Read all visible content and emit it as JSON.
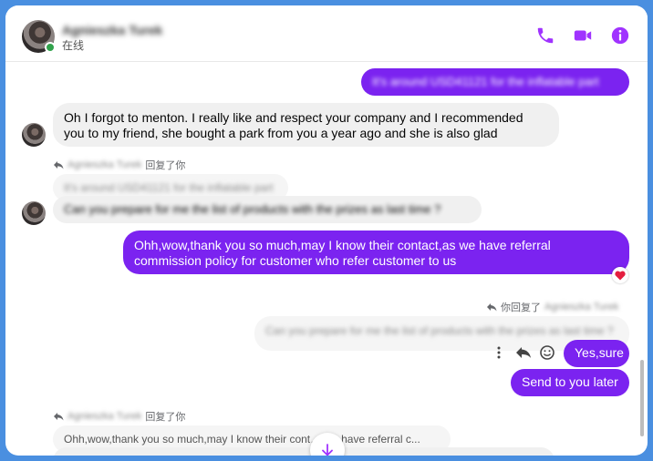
{
  "header": {
    "contact_name": "Agnieszka Turek",
    "status": "在线",
    "accent_color": "#a033ff"
  },
  "messages": [
    {
      "id": "m1",
      "direction": "out",
      "text": "It's around USD41121 for the inflatable part"
    },
    {
      "id": "m2",
      "direction": "in",
      "text_line1": "Oh I forgot to menton. I really like and respect your company and I recommended",
      "text_line2": "you to my friend, she bought a park from you a year ago and she is also glad"
    },
    {
      "id": "m3",
      "direction": "in",
      "reply_header_name": "Agnieszka Turek",
      "reply_header_suffix": "回复了你",
      "quoted_text": "It's around USD41121 for the inflatable part",
      "text": "Can you prepare for me the list of products with the prizes as last time ?"
    },
    {
      "id": "m4",
      "direction": "out",
      "text_line1": "Ohh,wow,thank you so much,may I know their contact,as we have referral",
      "text_line2": "commission policy for customer who  refer customer to us",
      "reaction": "heart"
    },
    {
      "id": "m5",
      "direction": "out",
      "reply_header_prefix": "你回复了",
      "reply_header_name": "Agnieszka Turek",
      "quoted_text": "Can you prepare for me the list of products with the prizes as last time ?",
      "text": "Yes,sure"
    },
    {
      "id": "m6",
      "direction": "out",
      "text": "Send to you later"
    },
    {
      "id": "m7",
      "direction": "in",
      "reply_header_name": "Agnieszka Turek",
      "reply_header_suffix": "回复了你",
      "quoted_text": "Ohh,wow,thank you so much,may I know their cont… we have referral c..."
    }
  ]
}
